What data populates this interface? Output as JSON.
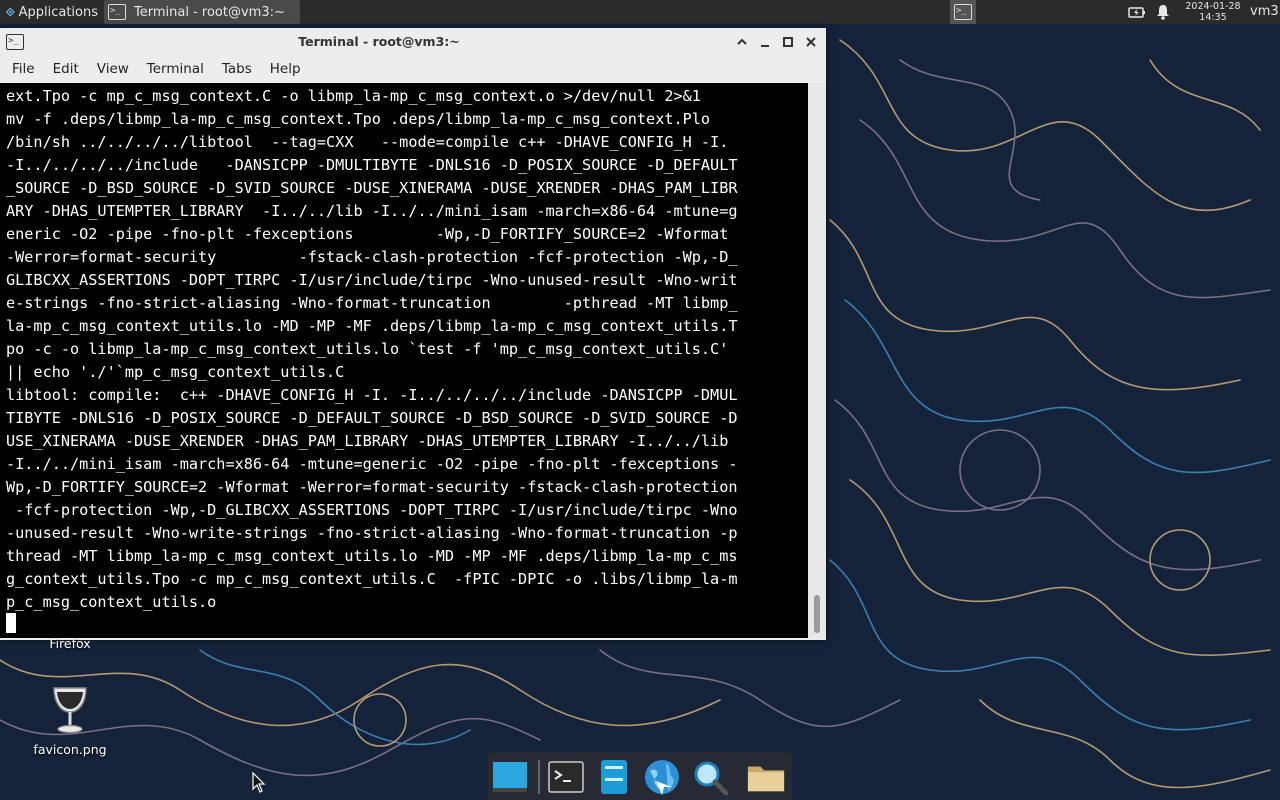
{
  "top_panel": {
    "applications_label": "Applications",
    "taskbar_terminal_label": "Terminal - root@vm3:~",
    "clock_date": "2024-01-28",
    "clock_time": "14:35",
    "user": "vm3"
  },
  "window": {
    "title": "Terminal - root@vm3:~",
    "menu": [
      "File",
      "Edit",
      "View",
      "Terminal",
      "Tabs",
      "Help"
    ]
  },
  "terminal": {
    "lines": [
      "ext.Tpo -c mp_c_msg_context.C -o libmp_la-mp_c_msg_context.o >/dev/null 2>&1",
      "mv -f .deps/libmp_la-mp_c_msg_context.Tpo .deps/libmp_la-mp_c_msg_context.Plo",
      "/bin/sh ../../../../libtool  --tag=CXX   --mode=compile c++ -DHAVE_CONFIG_H -I.",
      "-I../../../../include   -DANSICPP -DMULTIBYTE -DNLS16 -D_POSIX_SOURCE -D_DEFAULT",
      "_SOURCE -D_BSD_SOURCE -D_SVID_SOURCE -DUSE_XINERAMA -DUSE_XRENDER -DHAS_PAM_LIBR",
      "ARY -DHAS_UTEMPTER_LIBRARY  -I../../lib -I../../mini_isam -march=x86-64 -mtune=g",
      "eneric -O2 -pipe -fno-plt -fexceptions         -Wp,-D_FORTIFY_SOURCE=2 -Wformat",
      "-Werror=format-security         -fstack-clash-protection -fcf-protection -Wp,-D_",
      "GLIBCXX_ASSERTIONS -DOPT_TIRPC -I/usr/include/tirpc -Wno-unused-result -Wno-writ",
      "e-strings -fno-strict-aliasing -Wno-format-truncation        -pthread -MT libmp_",
      "la-mp_c_msg_context_utils.lo -MD -MP -MF .deps/libmp_la-mp_c_msg_context_utils.T",
      "po -c -o libmp_la-mp_c_msg_context_utils.lo `test -f 'mp_c_msg_context_utils.C'",
      "|| echo './'`mp_c_msg_context_utils.C",
      "libtool: compile:  c++ -DHAVE_CONFIG_H -I. -I../../../../include -DANSICPP -DMUL",
      "TIBYTE -DNLS16 -D_POSIX_SOURCE -D_DEFAULT_SOURCE -D_BSD_SOURCE -D_SVID_SOURCE -D",
      "USE_XINERAMA -DUSE_XRENDER -DHAS_PAM_LIBRARY -DHAS_UTEMPTER_LIBRARY -I../../lib",
      "-I../../mini_isam -march=x86-64 -mtune=generic -O2 -pipe -fno-plt -fexceptions -",
      "Wp,-D_FORTIFY_SOURCE=2 -Wformat -Werror=format-security -fstack-clash-protection",
      " -fcf-protection -Wp,-D_GLIBCXX_ASSERTIONS -DOPT_TIRPC -I/usr/include/tirpc -Wno",
      "-unused-result -Wno-write-strings -fno-strict-aliasing -Wno-format-truncation -p",
      "thread -MT libmp_la-mp_c_msg_context_utils.lo -MD -MP -MF .deps/libmp_la-mp_c_ms",
      "g_context_utils.Tpo -c mp_c_msg_context_utils.C  -fPIC -DPIC -o .libs/libmp_la-m",
      "p_c_msg_context_utils.o"
    ]
  },
  "desktop": {
    "icons": [
      {
        "label": "Firefox"
      },
      {
        "label": "favicon.png"
      }
    ]
  },
  "dock": {
    "items": [
      "desktop-icon",
      "terminal-icon",
      "file-manager-icon",
      "web-browser-icon",
      "search-icon",
      "folder-icon"
    ]
  },
  "colors": {
    "panel_bg": "#2b2b2b",
    "terminal_bg": "#000000",
    "terminal_fg": "#ffffff",
    "wallpaper_bg": "#15233a"
  }
}
